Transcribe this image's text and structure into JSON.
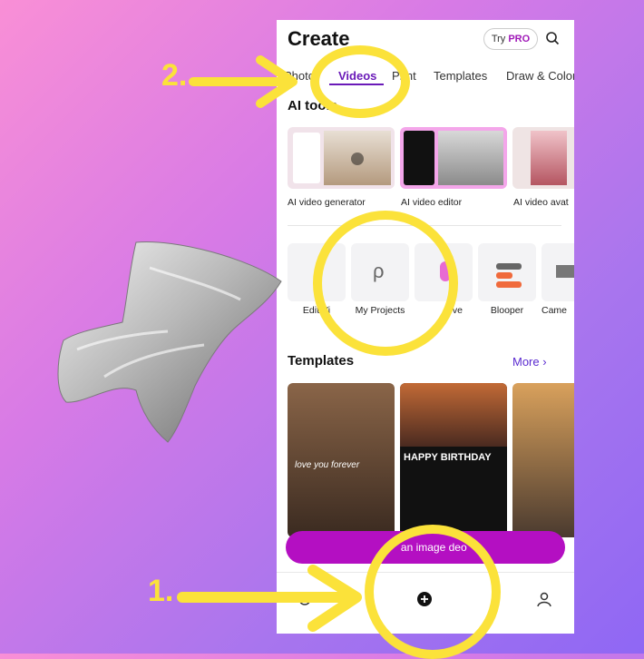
{
  "header": {
    "title": "Create",
    "try_label": "Try",
    "pro_label": "PRO"
  },
  "tabs": [
    "Photo",
    "Videos",
    "Print",
    "Templates",
    "Draw & Color"
  ],
  "ai_tools": {
    "title": "AI tools",
    "items": [
      {
        "label": "AI video generator"
      },
      {
        "label": "AI video editor"
      },
      {
        "label": "AI video avat"
      }
    ]
  },
  "tools": [
    {
      "label": "Edit Vi"
    },
    {
      "label": "My Projects"
    },
    {
      "label": "ove"
    },
    {
      "label": "Blooper"
    },
    {
      "label": "Came"
    }
  ],
  "templates": {
    "title": "Templates",
    "more": "More",
    "birthday_text": "HAPPY BIRTHDAY",
    "script_text": "love you forever"
  },
  "cta": {
    "label": "an image     deo"
  },
  "annotations": {
    "step1": "1.",
    "step2": "2."
  },
  "colors": {
    "accent": "#6a1ab8",
    "cta": "#b40fc2",
    "highlight": "#fbe23a"
  }
}
